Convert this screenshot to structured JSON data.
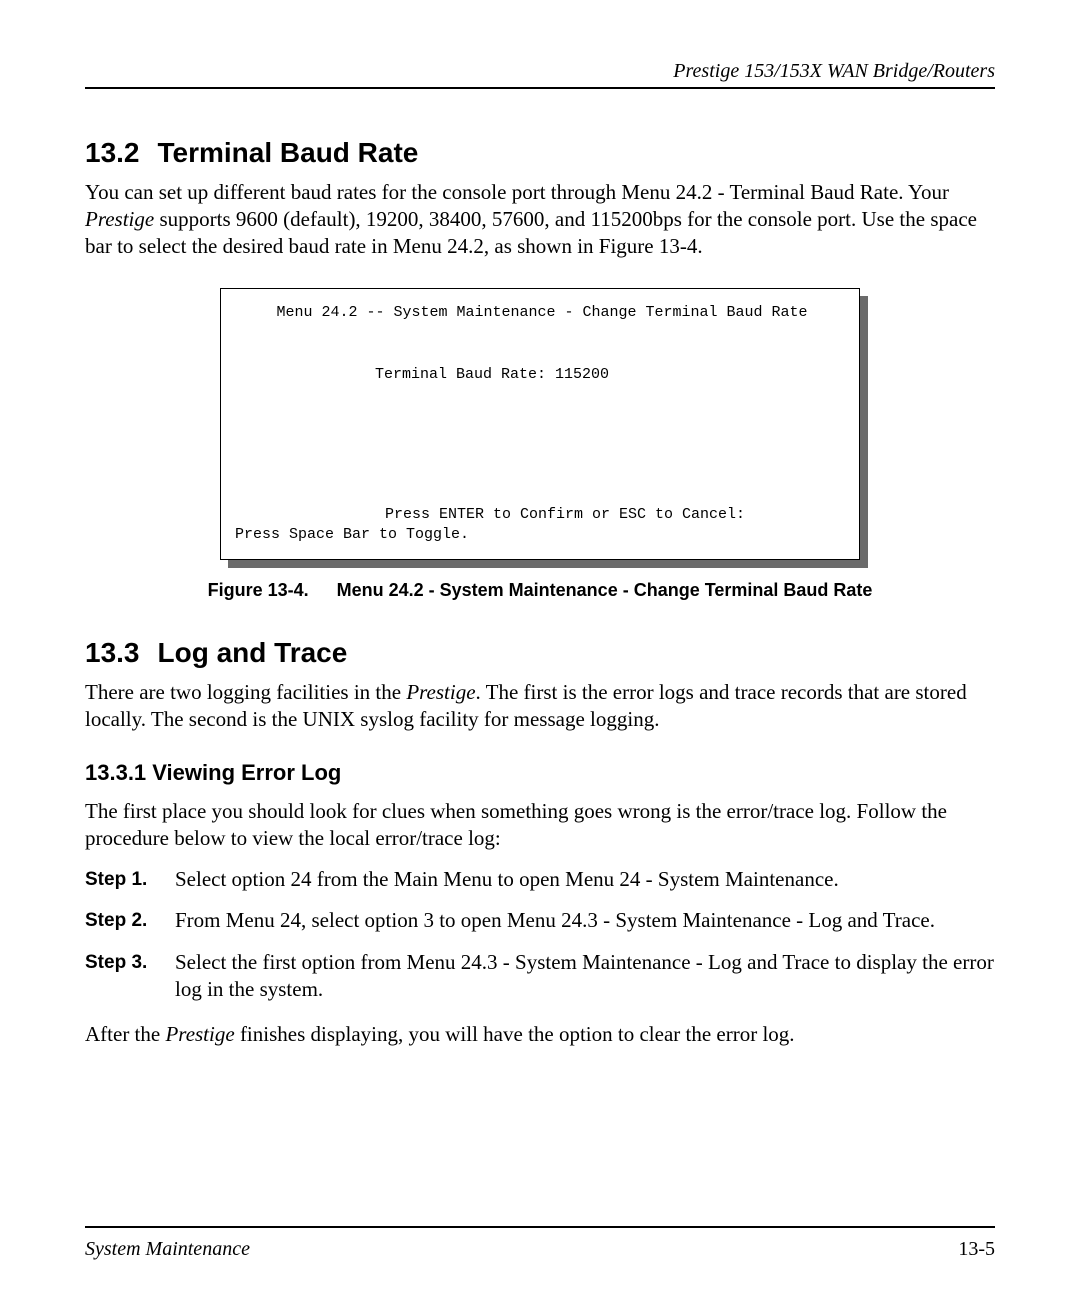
{
  "header": {
    "title": "Prestige 153/153X  WAN Bridge/Routers"
  },
  "section1": {
    "number": "13.2",
    "title": "Terminal Baud Rate",
    "para_before_italic": "You can set up different baud rates for the console port through Menu 24.2 - Terminal Baud Rate. Your ",
    "para_italic": "Prestige",
    "para_after_italic": " supports 9600 (default), 19200, 38400, 57600, and 115200bps for the console port. Use the space bar to select the desired baud rate in Menu 24.2, as shown in Figure 13-4."
  },
  "terminal": {
    "title": "Menu 24.2 -- System Maintenance - Change Terminal Baud Rate",
    "rate_line": "Terminal Baud Rate: 115200",
    "confirm_line": "Press ENTER to Confirm or ESC to Cancel:",
    "toggle_line": "Press Space Bar to Toggle."
  },
  "figure": {
    "number": "Figure 13-4.",
    "caption": "Menu 24.2 - System Maintenance - Change Terminal Baud Rate"
  },
  "section2": {
    "number": "13.3",
    "title": "Log and Trace",
    "para_before_italic": "There are two logging facilities in the ",
    "para_italic": "Prestige",
    "para_after_italic": ".  The first is the error logs and trace records that are stored locally.  The second is the UNIX syslog facility for message logging."
  },
  "subsection": {
    "number_title": "13.3.1 Viewing Error Log",
    "para": "The first place you should look for clues when something goes wrong is the error/trace log. Follow the procedure below to view the local error/trace log:"
  },
  "steps": [
    {
      "label": "Step 1.",
      "text": "Select option 24 from the Main Menu to open Menu 24 - System Maintenance."
    },
    {
      "label": "Step 2.",
      "text": "From Menu 24, select option 3 to open Menu 24.3 - System Maintenance - Log and Trace."
    },
    {
      "label": "Step 3.",
      "text": "Select the first option from Menu 24.3 - System Maintenance - Log and Trace to display the error log in the system."
    }
  ],
  "after_steps": {
    "before_italic": "After the ",
    "italic": "Prestige",
    "after_italic": " finishes displaying, you will have the option to clear the error log."
  },
  "footer": {
    "left": "System Maintenance",
    "right": "13-5"
  }
}
